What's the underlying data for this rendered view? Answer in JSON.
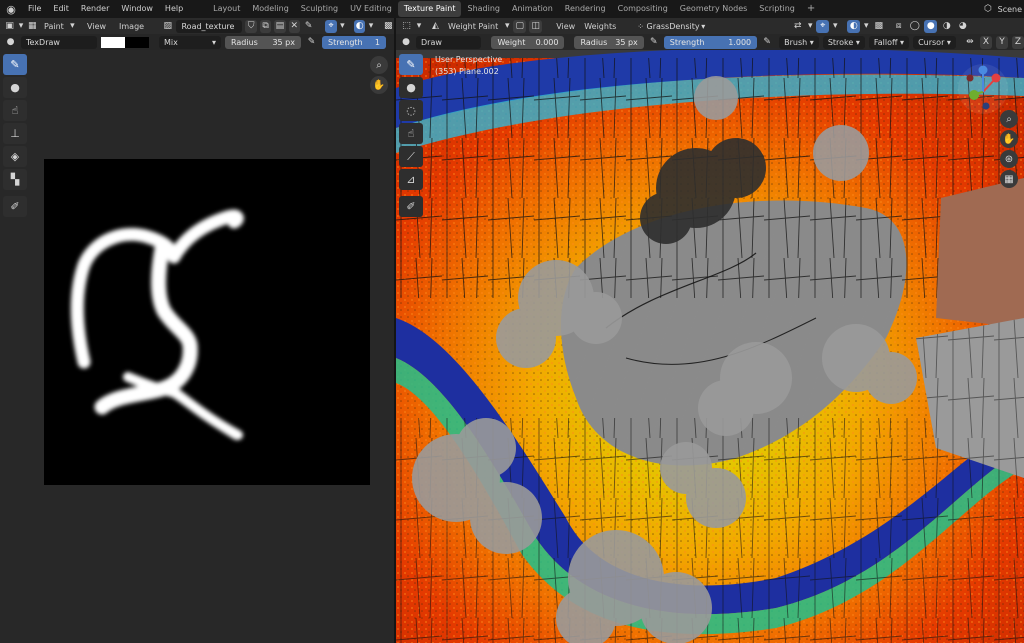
{
  "topbar": {
    "menu": [
      "File",
      "Edit",
      "Render",
      "Window",
      "Help"
    ],
    "workspaces": [
      "Layout",
      "Modeling",
      "Sculpting",
      "UV Editing",
      "Texture Paint",
      "Shading",
      "Animation",
      "Rendering",
      "Compositing",
      "Geometry Nodes",
      "Scripting"
    ],
    "active_workspace": "Texture Paint",
    "scene_label": "Scene"
  },
  "image_editor": {
    "mode": "Paint",
    "view_menu": "View",
    "image_menu": "Image",
    "image_name": "Road_texture",
    "brush_name": "TexDraw",
    "blend_mode": "Mix",
    "radius_label": "Radius",
    "radius_value": "35 px",
    "strength_label": "Strength",
    "strength_value": "1",
    "primary_color": "#ffffff",
    "secondary_color": "#000000",
    "tools": [
      "brush-icon",
      "blur-icon",
      "smear-icon",
      "clone-icon",
      "fill-icon",
      "mask-icon",
      "annotate-icon"
    ]
  },
  "viewport": {
    "mode": "Weight Paint",
    "view_menu": "View",
    "weights_menu": "Weights",
    "vertex_group": "GrassDensity",
    "brush_name": "Draw",
    "weight_label": "Weight",
    "weight_value": "0.000",
    "radius_label": "Radius",
    "radius_value": "35 px",
    "strength_label": "Strength",
    "strength_value": "1.000",
    "strength_fraction": 1.0,
    "menus": [
      "Brush",
      "Stroke",
      "Falloff",
      "Cursor"
    ],
    "symmetry_axes": [
      "X",
      "Y",
      "Z"
    ],
    "perspective": "User Perspective",
    "object_info": "(353) Plane.002",
    "tools": [
      "brush-icon",
      "blur-icon",
      "average-icon",
      "smear-icon",
      "gradient-icon",
      "sample-icon",
      "annotate-icon"
    ]
  },
  "colors": {
    "accent": "#4772b3",
    "header": "#2b2b2b",
    "editor_bg": "#282828"
  }
}
